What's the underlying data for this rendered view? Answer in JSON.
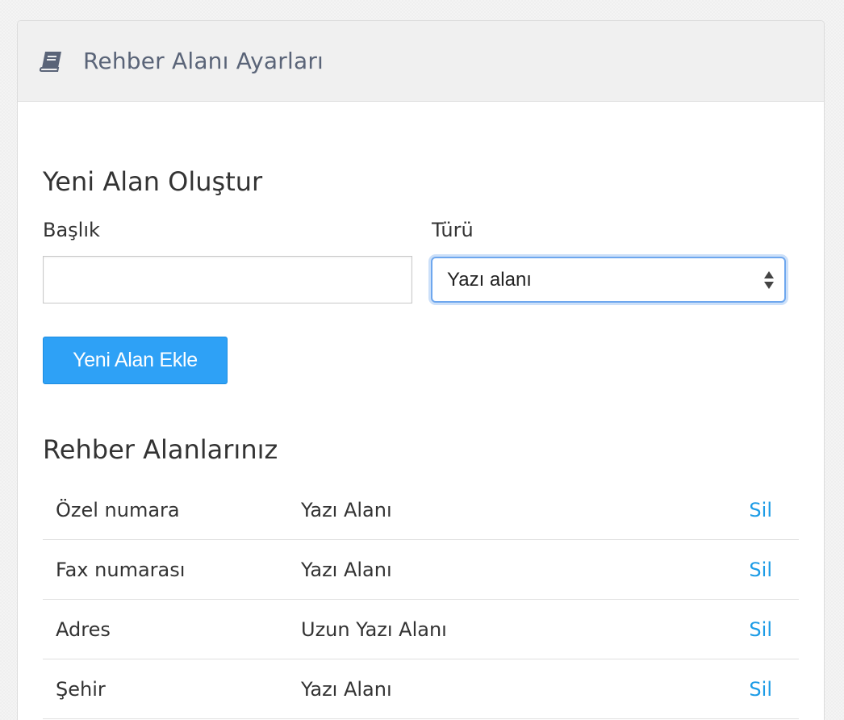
{
  "panel": {
    "title": "Rehber Alanı Ayarları",
    "icon": "book-icon"
  },
  "create_section": {
    "title": "Yeni Alan Oluştur",
    "title_label": "Başlık",
    "title_value": "",
    "type_label": "Türü",
    "type_selected": "Yazı alanı",
    "add_button_label": "Yeni Alan Ekle"
  },
  "list_section": {
    "title": "Rehber Alanlarınız",
    "rows": [
      {
        "name": "Özel numara",
        "type": "Yazı Alanı",
        "action": "Sil"
      },
      {
        "name": "Fax numarası",
        "type": "Yazı Alanı",
        "action": "Sil"
      },
      {
        "name": "Adres",
        "type": "Uzun Yazı Alanı",
        "action": "Sil"
      },
      {
        "name": "Şehir",
        "type": "Yazı Alanı",
        "action": "Sil"
      }
    ]
  },
  "colors": {
    "primary": "#2ea1f6",
    "link": "#1d9ce6",
    "focus": "#6ea7ee",
    "header_bg": "#f0f0f0"
  }
}
